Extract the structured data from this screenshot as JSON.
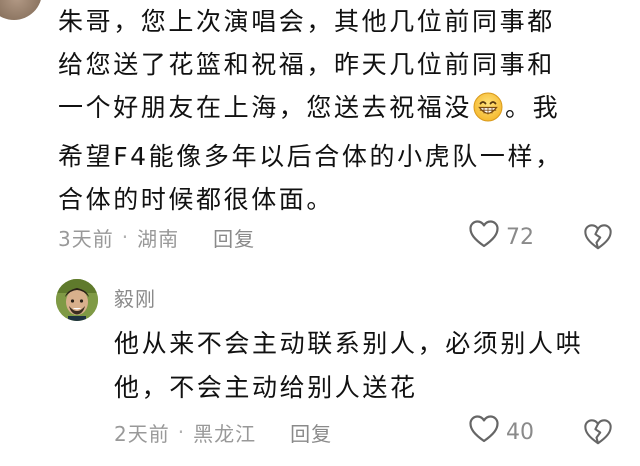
{
  "comment": {
    "lines": [
      "朱哥，您上次演唱会，其他几位前同事都",
      "给您送了花篮和祝福，昨天几位前同事和",
      "一个好朋友在上海，您送去祝福没",
      "。我",
      "希望F4能像多年以后合体的小虎队一样，",
      "合体的时候都很体面。"
    ],
    "emoji_icon": "grinning-face-emoji",
    "time": "3天前",
    "separator": "·",
    "location": "湖南",
    "reply_label": "回复",
    "like_count": "72"
  },
  "reply": {
    "author": "毅刚",
    "lines": [
      "他从来不会主动联系别人，必须别人哄",
      "他，不会主动给别人送花"
    ],
    "time": "2天前",
    "separator": "·",
    "location": "黑龙江",
    "reply_label": "回复",
    "like_count": "40"
  }
}
